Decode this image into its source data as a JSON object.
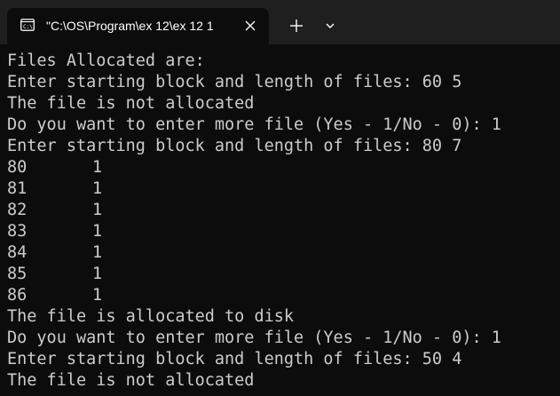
{
  "window": {
    "tab": {
      "icon": "terminal-icon",
      "title": "\"C:\\OS\\Program\\ex 12\\ex 12 1",
      "close_icon": "close-icon"
    },
    "new_tab_icon": "plus-icon",
    "dropdown_icon": "chevron-down-icon"
  },
  "colors": {
    "titlebar": "#1f1f1f",
    "background": "#0c0c0c",
    "text": "#cccccc"
  },
  "terminal": {
    "lines": [
      {
        "text": "Files Allocated are:"
      },
      {
        "text": "Enter starting block and length of files: 60 5"
      },
      {
        "text": "The file is not allocated"
      },
      {
        "text": "Do you want to enter more file (Yes - 1/No - 0): 1"
      },
      {
        "text": "Enter starting block and length of files: 80 7"
      },
      {
        "block": "80",
        "status": "1"
      },
      {
        "block": "81",
        "status": "1"
      },
      {
        "block": "82",
        "status": "1"
      },
      {
        "block": "83",
        "status": "1"
      },
      {
        "block": "84",
        "status": "1"
      },
      {
        "block": "85",
        "status": "1"
      },
      {
        "block": "86",
        "status": "1"
      },
      {
        "text": "The file is allocated to disk"
      },
      {
        "text": "Do you want to enter more file (Yes - 1/No - 0): 1"
      },
      {
        "text": "Enter starting block and length of files: 50 4"
      },
      {
        "text": "The file is not allocated"
      }
    ]
  }
}
